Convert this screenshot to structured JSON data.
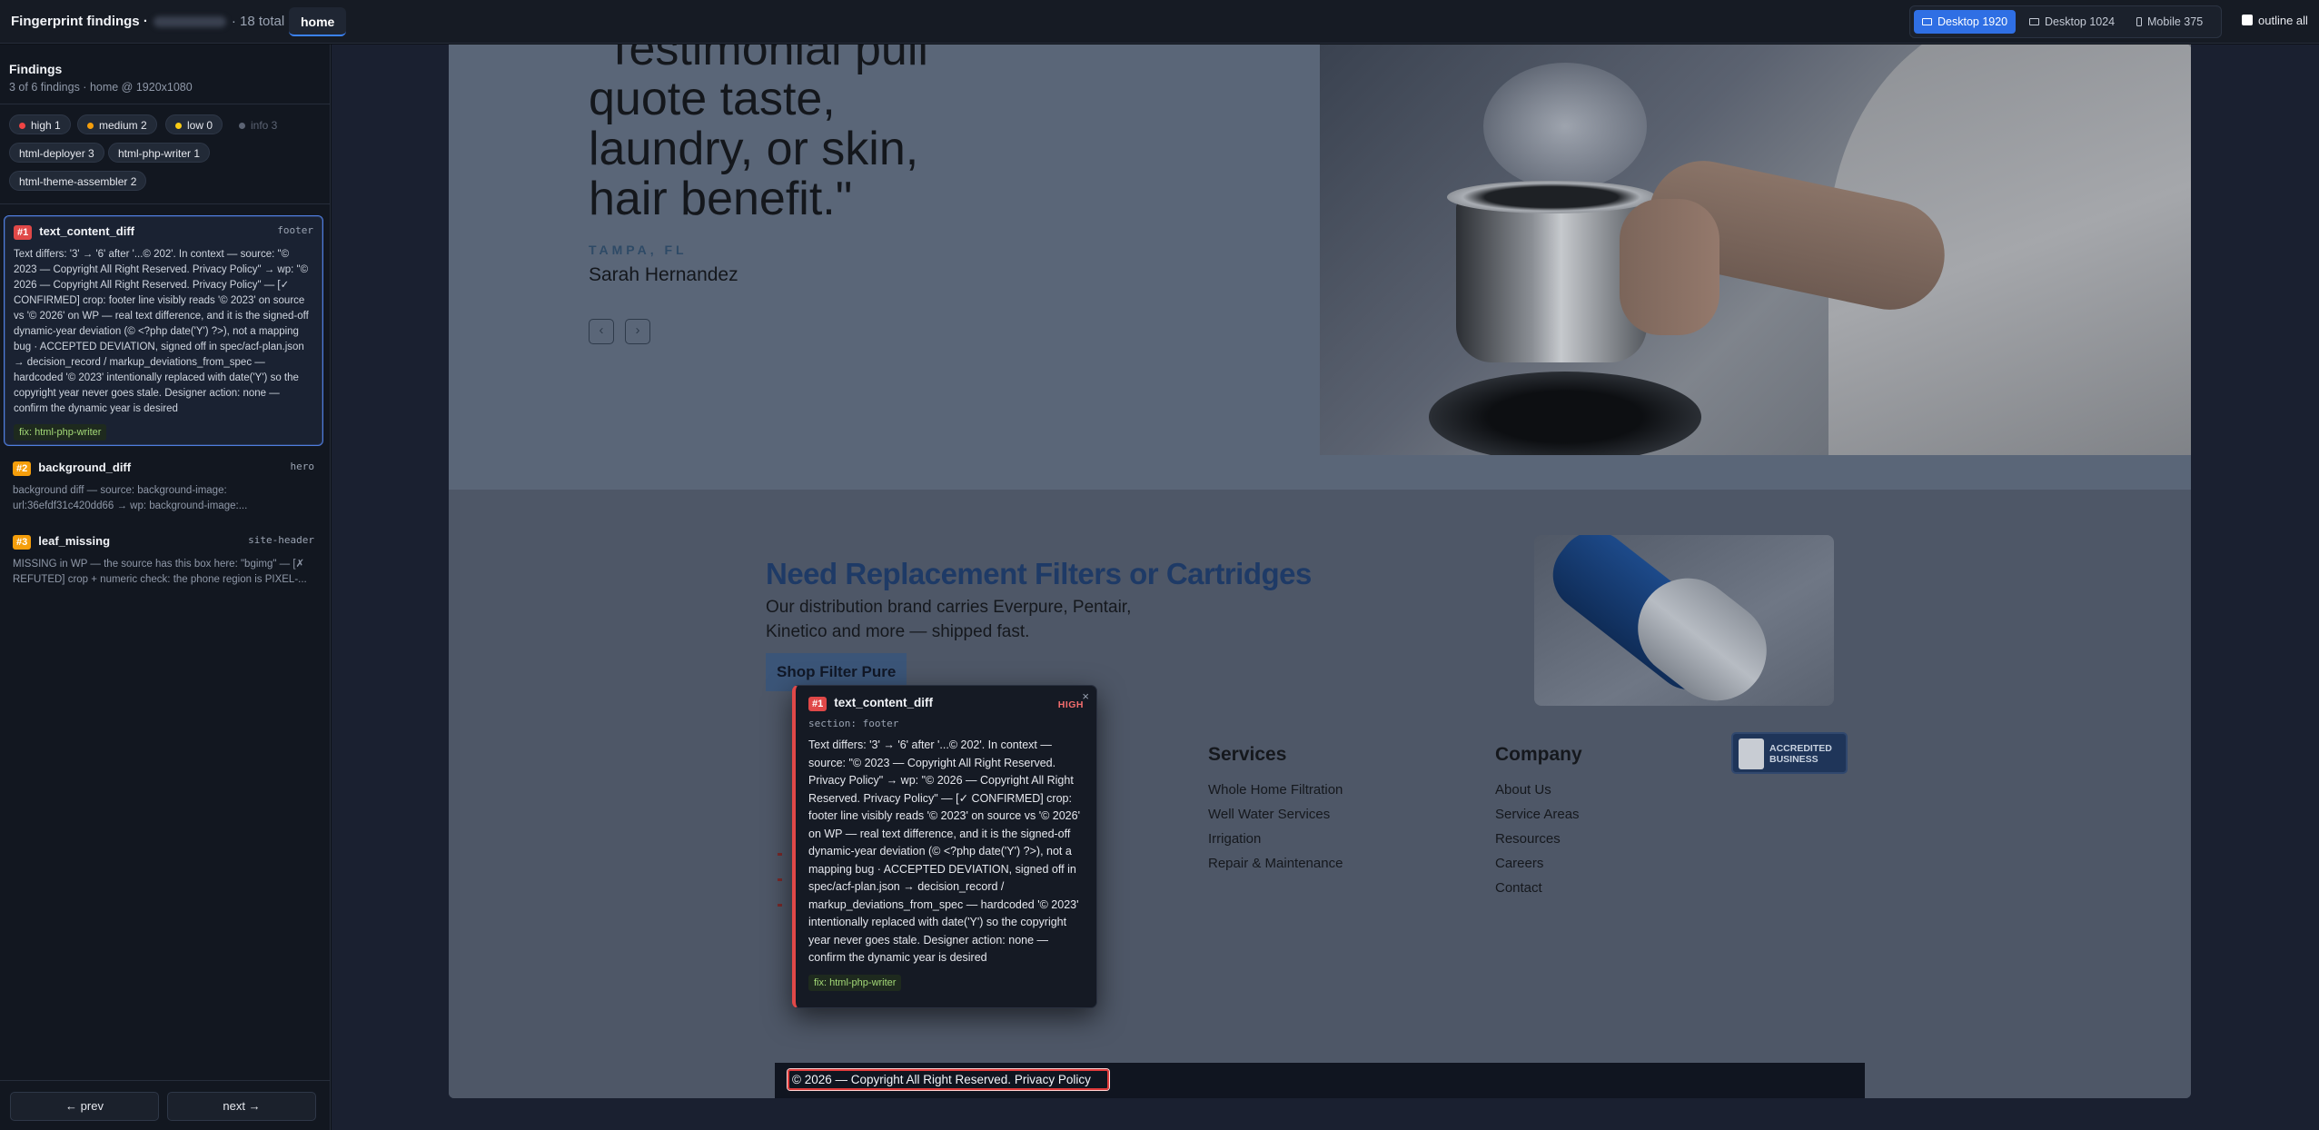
{
  "topbar": {
    "title": "Fingerprint findings ·",
    "total": "· 18 total",
    "page_tab": "home",
    "viewports": [
      {
        "label": "Desktop 1920",
        "icon": "desktop-icon",
        "active": true
      },
      {
        "label": "Desktop 1024",
        "icon": "desktop-icon",
        "active": false
      },
      {
        "label": "Mobile 375",
        "icon": "phone-icon",
        "active": false
      }
    ],
    "outline_label": "outline all"
  },
  "sidebar": {
    "title": "Findings",
    "subtitle": "3 of 6 findings · home @ 1920x1080",
    "severity_chips": [
      {
        "label": "high 1",
        "color": "#ef4444"
      },
      {
        "label": "medium 2",
        "color": "#f59e0b"
      },
      {
        "label": "low 0",
        "color": "#facc15"
      },
      {
        "label": "info 3",
        "color": "#5c6474"
      }
    ],
    "agent_chips": [
      "html-deployer 3",
      "html-php-writer 1",
      "html-theme-assembler 2"
    ],
    "findings": [
      {
        "badge": "#1",
        "name": "text_content_diff",
        "section": "footer",
        "body": "Text differs: '3' → '6' after '...© 202'. In context — source: \"© 2023 — Copyright All Right Reserved. Privacy Policy\" → wp: \"© 2026 — Copyright All Right Reserved. Privacy Policy\" — [✓ CONFIRMED] crop: footer line visibly reads '© 2023' on source vs '© 2026' on WP — real text difference, and it is the signed-off dynamic-year deviation (© <?php date('Y') ?>), not a mapping bug · ACCEPTED DEVIATION, signed off in spec/acf-plan.json → decision_record / markup_deviations_from_spec — hardcoded '© 2023' intentionally replaced with date('Y') so the copyright year never goes stale. Designer action: none — confirm the dynamic year is desired",
        "fix": "fix: html-php-writer",
        "badge_color": "#e04848"
      },
      {
        "badge": "#2",
        "name": "background_diff",
        "section": "hero",
        "body": "background diff — source: background-image: url:36efdf31c420dd66 → wp: background-image:...",
        "badge_color": "#f59e0b"
      },
      {
        "badge": "#3",
        "name": "leaf_missing",
        "section": "site-header",
        "body": "MISSING in WP — the source has this box here: \"bgimg\" — [✗ REFUTED] crop + numeric check: the phone region is PIXEL-...",
        "badge_color": "#f59e0b"
      }
    ],
    "prev_label": "← prev",
    "next_label": "next →"
  },
  "site": {
    "quote": "\"Testimonial pull quote taste, laundry, or skin, hair benefit.\"",
    "location": "TAMPA, FL",
    "person": "Sarah Hernandez",
    "prev_arrow": "‹",
    "next_arrow": "›",
    "filters_heading": "Need Replacement Filters or Cartridges",
    "filters_text": "Our distribution brand carries Everpure, Pentair, Kinetico and more — shipped fast.",
    "shop_button": "Shop Filter Pure",
    "services": {
      "heading": "Services",
      "links": [
        "Whole Home Filtration",
        "Well Water Services",
        "Irrigation",
        "Repair & Maintenance"
      ]
    },
    "company": {
      "heading": "Company",
      "links": [
        "About Us",
        "Service Areas",
        "Resources",
        "Careers",
        "Contact"
      ]
    },
    "bbb": {
      "line1": "ACCREDITED",
      "line2": "BUSINESS",
      "logo": "BBB"
    },
    "footer_text": "© 2026 — Copyright All Right Reserved.    Privacy Policy"
  },
  "popover": {
    "badge": "#1",
    "name": "text_content_diff",
    "severity": "HIGH",
    "close": "×",
    "section": "section: footer",
    "body": "Text differs: '3' → '6' after '...© 202'. In context — source: \"© 2023 — Copyright All Right Reserved. Privacy Policy\" → wp: \"© 2026 — Copyright All Right Reserved. Privacy Policy\" — [✓ CONFIRMED] crop: footer line visibly reads '© 2023' on source vs '© 2026' on WP — real text difference, and it is the signed-off dynamic-year deviation (© <?php date('Y') ?>), not a mapping bug · ACCEPTED DEVIATION, signed off in spec/acf-plan.json → decision_record / markup_deviations_from_spec — hardcoded '© 2023' intentionally replaced with date('Y') so the copyright year never goes stale. Designer action: none — confirm the dynamic year is desired",
    "fix": "fix: html-php-writer"
  },
  "colors": {
    "accent": "#2f6fe4",
    "high": "#ef4444",
    "medium": "#f59e0b",
    "low": "#facc15"
  }
}
